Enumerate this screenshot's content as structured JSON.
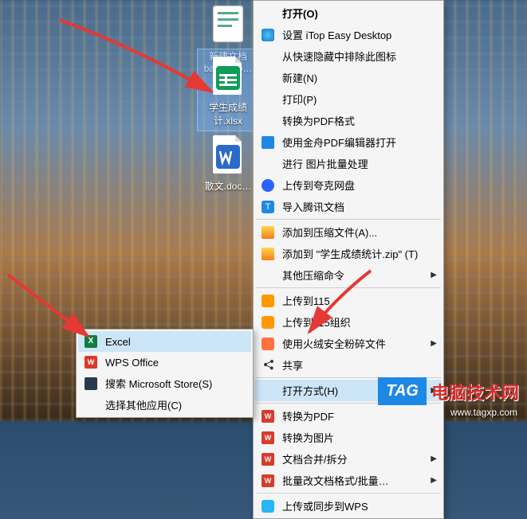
{
  "desktop_icons": {
    "backup": {
      "line1": "新建文档",
      "line2": "backup.p…"
    },
    "xlsx": {
      "line1": "学生成绩",
      "line2": "计.xlsx"
    },
    "docx": {
      "line1": "散文.doc…"
    }
  },
  "main_menu": [
    {
      "type": "item",
      "label": "打开(O)",
      "icon": "",
      "bold": true
    },
    {
      "type": "item",
      "label": "设置 iTop Easy Desktop",
      "icon": "itop"
    },
    {
      "type": "item",
      "label": "从快速隐藏中排除此图标",
      "icon": ""
    },
    {
      "type": "item",
      "label": "新建(N)",
      "icon": ""
    },
    {
      "type": "item",
      "label": "打印(P)",
      "icon": ""
    },
    {
      "type": "item",
      "label": "转换为PDF格式",
      "icon": ""
    },
    {
      "type": "item",
      "label": "使用金舟PDF编辑器打开",
      "icon": "pdf-blue"
    },
    {
      "type": "item",
      "label": "进行 图片批量处理",
      "icon": ""
    },
    {
      "type": "item",
      "label": "上传到夸克网盘",
      "icon": "quark"
    },
    {
      "type": "item",
      "label": "导入腾讯文档",
      "icon": "tencent"
    },
    {
      "type": "sep"
    },
    {
      "type": "item",
      "label": "添加到压缩文件(A)...",
      "icon": "zip"
    },
    {
      "type": "item",
      "label": "添加到 \"学生成绩统计.zip\" (T)",
      "icon": "zip"
    },
    {
      "type": "item",
      "label": "其他压缩命令",
      "icon": "",
      "arrow": true
    },
    {
      "type": "sep"
    },
    {
      "type": "item",
      "label": "上传到115",
      "icon": "115"
    },
    {
      "type": "item",
      "label": "上传到115组织",
      "icon": "115"
    },
    {
      "type": "item",
      "label": "使用火绒安全粉碎文件",
      "icon": "huorong",
      "arrow": true
    },
    {
      "type": "item",
      "label": "共享",
      "icon": "share"
    },
    {
      "type": "sep"
    },
    {
      "type": "item",
      "label": "打开方式(H)",
      "icon": "",
      "arrow": true,
      "highlighted": true
    },
    {
      "type": "sep"
    },
    {
      "type": "item",
      "label": "转换为PDF",
      "icon": "wps-red"
    },
    {
      "type": "item",
      "label": "转换为图片",
      "icon": "wps-red"
    },
    {
      "type": "item",
      "label": "文档合并/拆分",
      "icon": "wps-red",
      "arrow": true
    },
    {
      "type": "item",
      "label": "批量改文档格式/批量…",
      "icon": "wps-red",
      "arrow": true
    },
    {
      "type": "sep"
    },
    {
      "type": "item",
      "label": "上传或同步到WPS",
      "icon": "wps-cloud"
    }
  ],
  "sub_menu": [
    {
      "label": "Excel",
      "icon": "excel",
      "highlighted": true
    },
    {
      "label": "WPS Office",
      "icon": "wps-red"
    },
    {
      "label": "搜索 Microsoft Store(S)",
      "icon": "store"
    },
    {
      "label": "选择其他应用(C)",
      "icon": ""
    }
  ],
  "watermark": {
    "tag": "TAG",
    "text": "电脑技术网",
    "url": "www.tagxp.com"
  },
  "colors": {
    "excel": "#107c41",
    "wps": "#d93a2b",
    "highlight": "#cde6f7",
    "store": "#2b3a4a",
    "tencent": "#1e88e5",
    "115": "#ff9800"
  }
}
